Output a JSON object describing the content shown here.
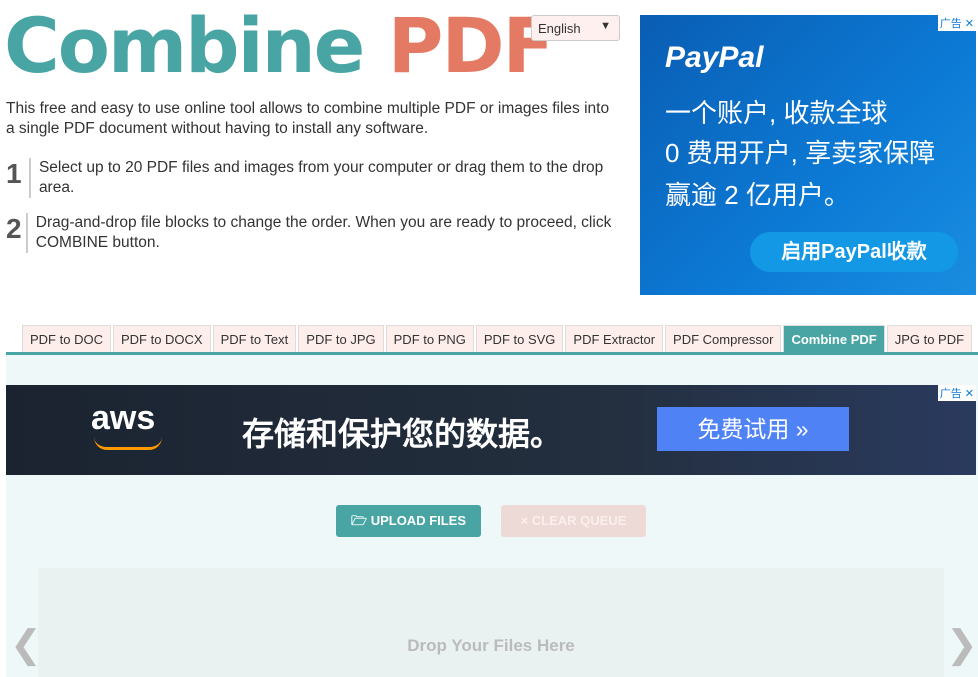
{
  "logo": {
    "part1": "Combine",
    "part2": "PDF"
  },
  "language": {
    "selected": "English"
  },
  "intro": "This free and easy to use online tool allows to combine multiple PDF or images files into a single PDF document without having to install any software.",
  "steps": [
    {
      "num": "1",
      "text": "Select up to 20 PDF files and images from your computer or drag them to the drop area."
    },
    {
      "num": "2",
      "text": "Drag-and-drop file blocks to change the order. When you are ready to proceed, click COMBINE button."
    }
  ],
  "ad_paypal": {
    "brand": "PayPal",
    "line1": "一个账户, 收款全球",
    "line2": "0 费用开户, 享卖家保障",
    "line3": "赢逾 2 亿用户。",
    "button": "启用PayPal收款",
    "ad_label": "广告 ✕"
  },
  "tabs": [
    {
      "label": "PDF to DOC"
    },
    {
      "label": "PDF to DOCX"
    },
    {
      "label": "PDF to Text"
    },
    {
      "label": "PDF to JPG"
    },
    {
      "label": "PDF to PNG"
    },
    {
      "label": "PDF to SVG"
    },
    {
      "label": "PDF Extractor"
    },
    {
      "label": "PDF Compressor"
    },
    {
      "label": "Combine PDF",
      "active": true
    },
    {
      "label": "JPG to PDF"
    }
  ],
  "ad_aws": {
    "brand": "aws",
    "text": "存储和保护您的数据。",
    "button": "免费试用 »",
    "ad_label": "广告 ✕"
  },
  "buttons": {
    "upload": "UPLOAD FILES",
    "clear": "CLEAR QUEUE"
  },
  "drop": {
    "text": "Drop Your Files Here",
    "prev": "❮",
    "next": "❯"
  },
  "colors": {
    "accent": "#48a5a4",
    "pdf": "#e57a64"
  }
}
